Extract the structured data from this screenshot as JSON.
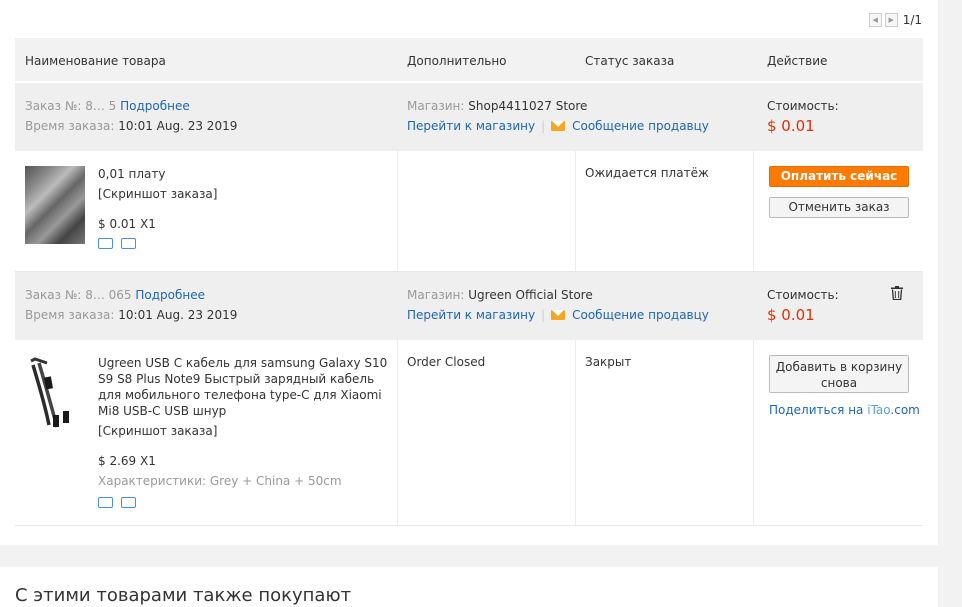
{
  "pager": {
    "text": "1/1"
  },
  "headers": {
    "product": "Наименование товара",
    "extra": "Дополнительно",
    "status": "Статус заказа",
    "action": "Действие"
  },
  "labels": {
    "order_no": "Заказ №:",
    "order_time": "Время заказа:",
    "store": "Магазин:",
    "cost": "Стоимость:",
    "more": "Подробнее",
    "goto_store": "Перейти к магазину",
    "message_seller": "Сообщение продавцу",
    "snapshot": "[Скриншот заказа]"
  },
  "orders": [
    {
      "order_no": "8… 5",
      "time": "10:01 Aug. 23 2019",
      "store": "Shop4411027 Store",
      "cost": "$ 0.01",
      "product_title": "0,01 плату",
      "price_qty": "$ 0.01 X1",
      "extra": "",
      "status": "Ожидается платёж",
      "primary_button": "Оплатить сейчас",
      "secondary_button": "Отменить заказ"
    },
    {
      "order_no": "8… 065",
      "time": "10:01 Aug. 23 2019",
      "store": "Ugreen Official Store",
      "cost": "$ 0.01",
      "product_title": "Ugreen USB C кабель для samsung Galaxy S10 S9 S8 Plus Note9 Быстрый зарядный кабель для мобильного телефона type-C для Xiaomi Mi8 USB-C USB шнур",
      "price_qty": "$ 2.69 X1",
      "specs": "Характеристики: Grey + China + 50cm",
      "extra": "Order Closed",
      "status": "Закрыт",
      "button": "Добавить в корзину снова",
      "share_prefix": "Поделиться на ",
      "share_brand": "iTao",
      "share_suffix": ".com"
    }
  ],
  "bottom": {
    "title": "С этими товарами также покупают"
  },
  "colors": {
    "accent": "#ff7a00",
    "price": "#e62e04",
    "link": "#1d65b5"
  }
}
